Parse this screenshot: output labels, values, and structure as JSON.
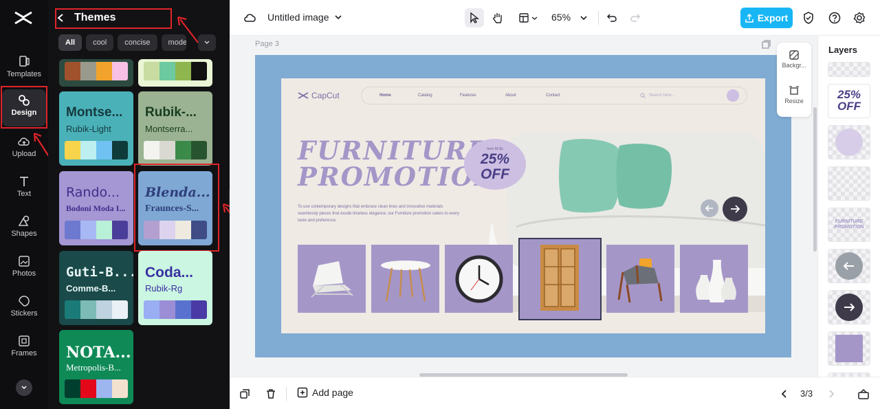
{
  "rail": {
    "items": [
      {
        "label": "Templates"
      },
      {
        "label": "Design"
      },
      {
        "label": "Upload"
      },
      {
        "label": "Text"
      },
      {
        "label": "Shapes"
      },
      {
        "label": "Photos"
      },
      {
        "label": "Stickers"
      },
      {
        "label": "Frames"
      }
    ]
  },
  "panel": {
    "title": "Themes",
    "chips": [
      "All",
      "cool",
      "concise",
      "mode"
    ],
    "cards": [
      {
        "title": "Montse...",
        "subtitle": "Rubik-Light",
        "bg": "#4bb1b9",
        "fg": "#143a3e",
        "swatches": [
          "#f7d44c",
          "#bdeff0",
          "#6fc2f2",
          "#0f3b3b"
        ]
      },
      {
        "title": "Rubik-...",
        "subtitle": "Montserra...",
        "bg": "#9bb392",
        "fg": "#173d1f",
        "swatches": [
          "#f3f3ef",
          "#d9d9d2",
          "#3b8a4a",
          "#27542f"
        ]
      },
      {
        "title": "Rando...",
        "subtitle": "Bodoni Moda I...",
        "bg": "#a596d4",
        "fg": "#3f2f8a",
        "swatches": [
          "#6d79cf",
          "#a8b8f4",
          "#b9f0d8",
          "#4b3e9a"
        ]
      },
      {
        "title": "Blenda...",
        "subtitle": "Fraunces-S...",
        "bg": "#7fa8d4",
        "fg": "#2e3e7a",
        "swatches": [
          "#b39fd0",
          "#ddd3ee",
          "#efeae0",
          "#3f4c86"
        ]
      },
      {
        "title": "Guti-B...",
        "subtitle": "Comme-B...",
        "bg": "#1a4a49",
        "fg": "#e8f6f5",
        "swatches": [
          "#1b7b78",
          "#7dbbb6",
          "#bed3df",
          "#e9f1f6"
        ]
      },
      {
        "title": "Coda...",
        "subtitle": "Rubik-Rg",
        "bg": "#cbf6e2",
        "fg": "#3a2fa0",
        "swatches": [
          "#99aef3",
          "#9b8ed6",
          "#5a72cf",
          "#4a3aa6"
        ]
      },
      {
        "title": "NOTA...",
        "subtitle": "Metropolis-B...",
        "bg": "#0f8a57",
        "fg": "#ffffff",
        "swatches": [
          "#003f2d",
          "#e3091a",
          "#9db6ef",
          "#f3e1cf"
        ]
      }
    ],
    "top_swatches_left": [
      "#a0522d",
      "#9a9a8c",
      "#f2a32b",
      "#f7c0e4"
    ],
    "top_swatches_right": [
      "#c8dba0",
      "#6dc9a0",
      "#8fb64e",
      "#111111"
    ]
  },
  "topbar": {
    "title": "Untitled image",
    "zoom": "65%",
    "export_label": "Export"
  },
  "canvas": {
    "page_label": "Page 3",
    "design": {
      "brand": "CapCut",
      "nav": [
        "Home",
        "Catalog",
        "Features",
        "About",
        "Contact"
      ],
      "search_placeholder": "Search here...",
      "headline_1": "FURNITURE",
      "headline_2": "PROMOTION",
      "badge_small": "from 99 $s",
      "badge_big_1": "25%",
      "badge_big_2": "OFF",
      "body": "To use contemporary designs that embrace clean lines and innovative materials seamlessly pieces that exude timeless elegance, our Furniture promotion caters to every taste and preference."
    },
    "mini_tools": [
      {
        "label": "Backgr..."
      },
      {
        "label": "Resize"
      }
    ]
  },
  "layers": {
    "title": "Layers",
    "thumb_text_1": "25%",
    "thumb_text_2": "OFF",
    "thumb_promo_1": "FURNITURE",
    "thumb_promo_2": "PROMOTION"
  },
  "bottombar": {
    "add_page": "Add page",
    "pager": "3/3"
  },
  "colors": {
    "accent": "#18b6f5",
    "highlight": "#e0242a",
    "purple": "#a596c8"
  }
}
